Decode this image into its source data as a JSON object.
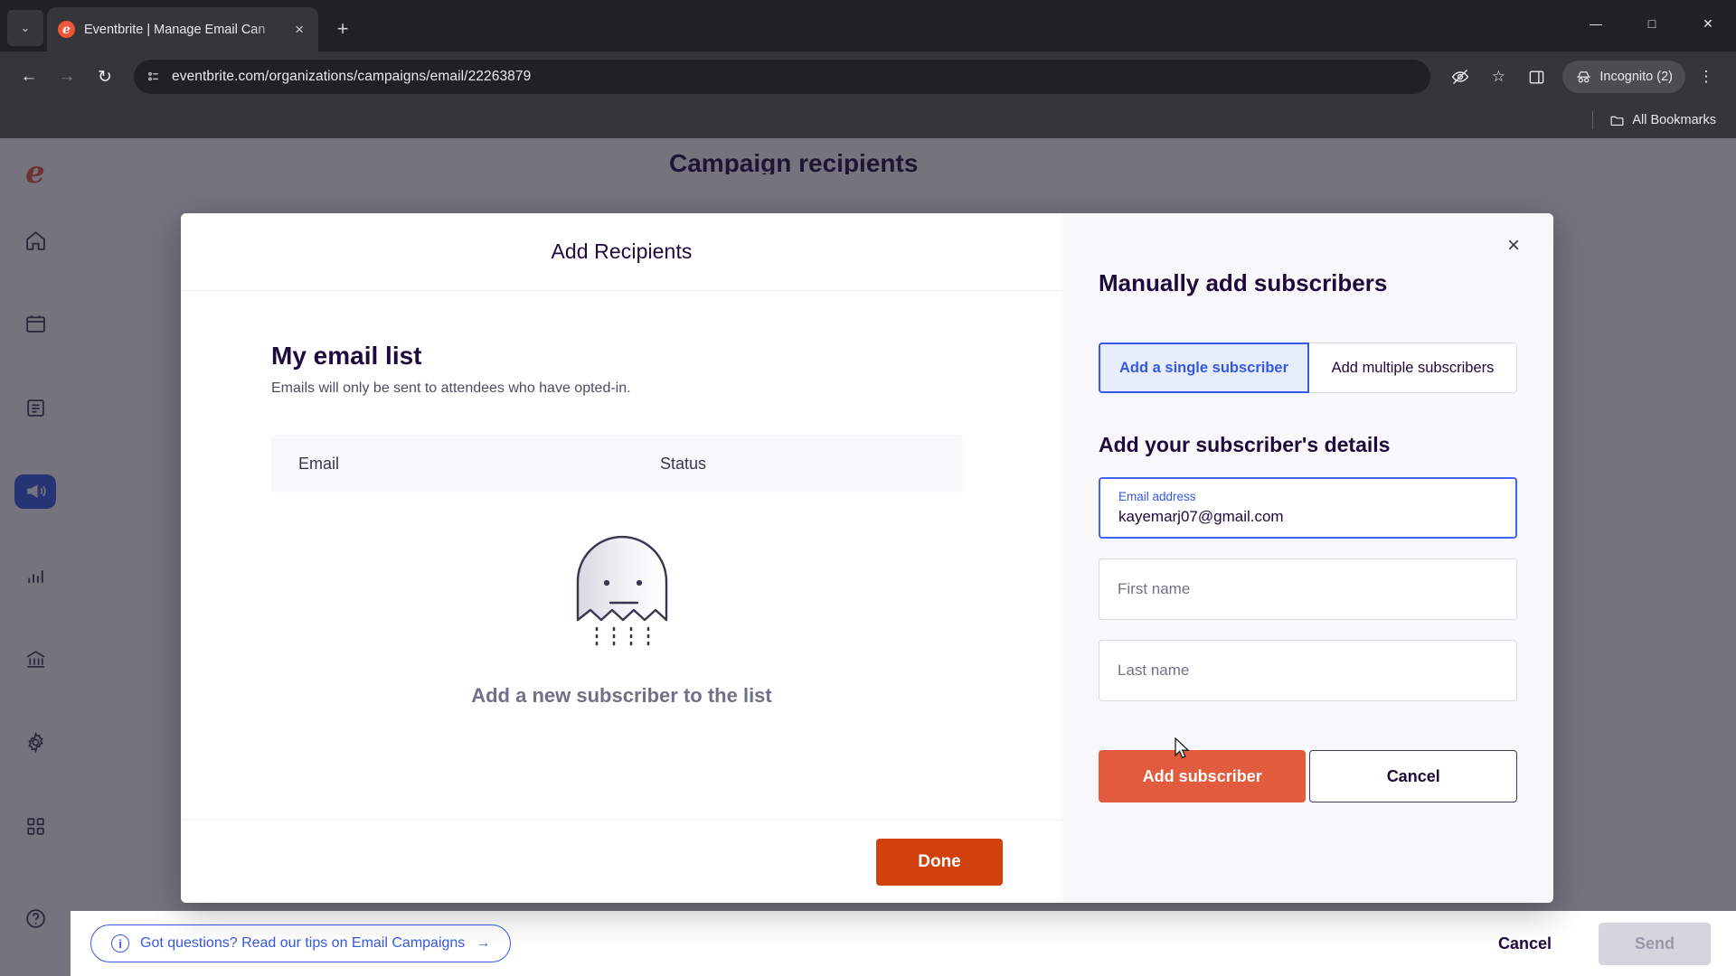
{
  "browser": {
    "tab": {
      "title": "Eventbrite | Manage Email Can",
      "favicon": "eventbrite-logo-icon",
      "close": "×"
    },
    "new_tab": "+",
    "tab_list": "⌄",
    "window": {
      "minimize": "—",
      "maximize": "□",
      "close": "✕"
    },
    "nav": {
      "back": "←",
      "forward": "→",
      "reload": "↻"
    },
    "url": "eventbrite.com/organizations/campaigns/email/22263879",
    "site_info_icon": "page-info-icon",
    "actions": {
      "tracking_protection": "eye-off-icon",
      "bookmark": "☆",
      "side_panel": "side-panel-icon",
      "menu": "⋮"
    },
    "incognito": {
      "label": "Incognito (2)",
      "icon": "incognito-hat-icon"
    },
    "bookmarks_bar": {
      "label": "All Bookmarks",
      "icon": "folder-icon"
    }
  },
  "sidebar": {
    "logo": "e",
    "items": [
      {
        "name": "home",
        "label": "Home"
      },
      {
        "name": "events",
        "label": "Events"
      },
      {
        "name": "orders",
        "label": "Orders"
      },
      {
        "name": "marketing",
        "label": "Marketing",
        "active": true
      },
      {
        "name": "reports",
        "label": "Reports"
      },
      {
        "name": "finance",
        "label": "Finance"
      },
      {
        "name": "settings",
        "label": "Settings"
      },
      {
        "name": "apps",
        "label": "Apps"
      },
      {
        "name": "help",
        "label": "Help"
      }
    ]
  },
  "page": {
    "title": "Campaign recipients",
    "tips_link": "Got questions? Read our tips on Email Campaigns",
    "tips_arrow": "→",
    "tips_info": "i",
    "cancel_label": "Cancel",
    "send_label": "Send"
  },
  "modal": {
    "title": "Add Recipients",
    "close": "×",
    "left": {
      "heading": "My email list",
      "subtext": "Emails will only be sent to attendees who have opted-in.",
      "table": {
        "columns": [
          "Email",
          "Status"
        ],
        "rows": []
      },
      "empty_state": {
        "illustration": "ghost-illustration",
        "text": "Add a new subscriber to the list"
      },
      "done_label": "Done"
    },
    "right": {
      "heading": "Manually add subscribers",
      "tabs": [
        {
          "label": "Add a single subscriber",
          "selected": true
        },
        {
          "label": "Add multiple subscribers",
          "selected": false
        }
      ],
      "form_heading": "Add your subscriber's details",
      "fields": [
        {
          "name": "email",
          "label": "Email address",
          "value": "kayemarj07@gmail.com",
          "placeholder": "Email address",
          "filled": true
        },
        {
          "name": "first-name",
          "label": "First name",
          "value": "",
          "placeholder": "First name",
          "filled": false
        },
        {
          "name": "last-name",
          "label": "Last name",
          "value": "",
          "placeholder": "Last name",
          "filled": false
        }
      ],
      "submit_label": "Add subscriber",
      "cancel_label": "Cancel"
    }
  },
  "colors": {
    "brand_orange": "#f05537",
    "done_orange": "#d1410c",
    "add_orange": "#e35b3d",
    "accent_blue": "#3659e3",
    "dark_purple": "#1e0a3c"
  }
}
